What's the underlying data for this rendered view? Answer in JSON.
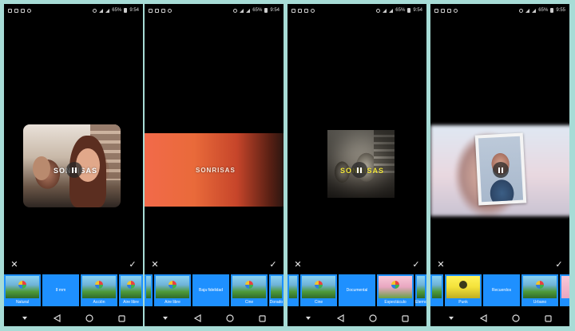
{
  "background_color": "#a7dcd6",
  "accent_color": "#1e90ff",
  "screens": [
    {
      "status": {
        "battery": "65%",
        "time": "9:54"
      },
      "title": "SONRISAS",
      "title_color": "#ffffff",
      "playback": "pause",
      "filters": [
        "Natural",
        "8 mm",
        "Acción",
        "Aire libre"
      ]
    },
    {
      "status": {
        "battery": "65%",
        "time": "9:54"
      },
      "title": "SONRISAS",
      "title_color": "#ffffff",
      "playback": "none",
      "filters": [
        "Aire libre",
        "Baja fidelidad",
        "Cine",
        "Dorado"
      ]
    },
    {
      "status": {
        "battery": "65%",
        "time": "9:54"
      },
      "title": "SONRISAS",
      "title_color": "#f4e83a",
      "playback": "pause",
      "filters": [
        "Cine",
        "Documental",
        "Espectáculo",
        "Eterno"
      ]
    },
    {
      "status": {
        "battery": "65%",
        "time": "9:55"
      },
      "title": "",
      "playback": "pause",
      "filters": [
        "Punk",
        "Recuerdos",
        "Urbano"
      ]
    }
  ],
  "icons": {
    "discard": "close-icon",
    "confirm": "check-icon",
    "nav_menu": "chevron-down-icon",
    "nav_back": "back-triangle-icon",
    "nav_home": "home-circle-icon",
    "nav_recents": "recents-square-icon"
  }
}
